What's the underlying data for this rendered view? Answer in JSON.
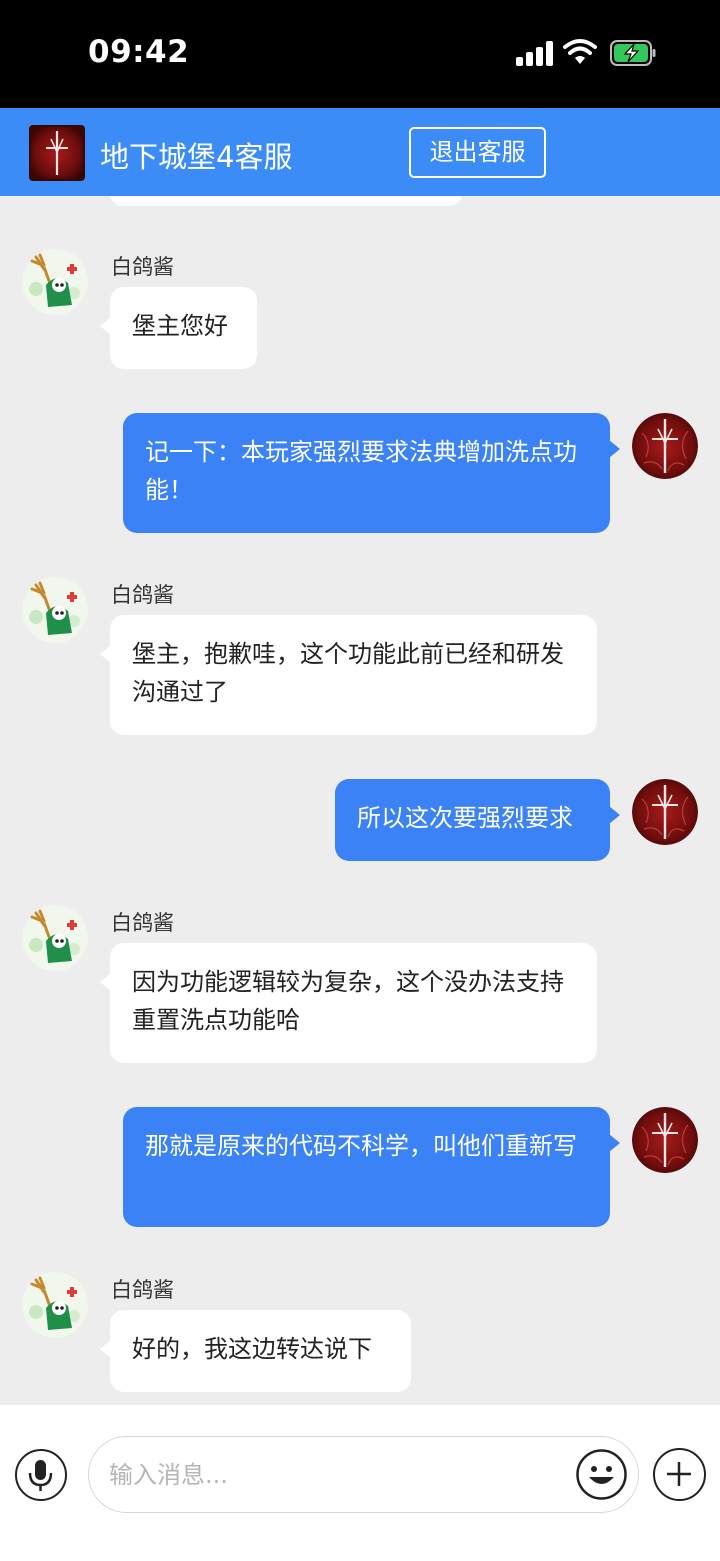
{
  "status_bar": {
    "time": "09:42"
  },
  "header": {
    "title": "地下城堡4客服",
    "exit_label": "退出客服"
  },
  "messages": [
    {
      "side": "left",
      "sender": "白鸽酱",
      "text": "堡主您好"
    },
    {
      "side": "right",
      "text": "记一下：本玩家强烈要求法典增加洗点功能！"
    },
    {
      "side": "left",
      "sender": "白鸽酱",
      "text": "堡主，抱歉哇，这个功能此前已经和研发沟通过了"
    },
    {
      "side": "right",
      "text": "所以这次要强烈要求"
    },
    {
      "side": "left",
      "sender": "白鸽酱",
      "text": "因为功能逻辑较为复杂，这个没办法支持重置洗点功能哈"
    },
    {
      "side": "right",
      "text": "那就是原来的代码不科学，叫他们重新写"
    },
    {
      "side": "left",
      "sender": "白鸽酱",
      "text": "好的，我这边转达说下"
    }
  ],
  "input": {
    "placeholder": "输入消息..."
  },
  "icons": {
    "status": [
      "cellular-signal-icon",
      "wifi-icon",
      "battery-charging-icon"
    ],
    "input_bar": [
      "microphone-icon",
      "emoji-icon",
      "plus-icon"
    ]
  },
  "colors": {
    "header": "#3b8cf6",
    "outgoing_bubble": "#3b82f6",
    "incoming_bubble": "#ffffff",
    "chat_background": "#ededed"
  }
}
